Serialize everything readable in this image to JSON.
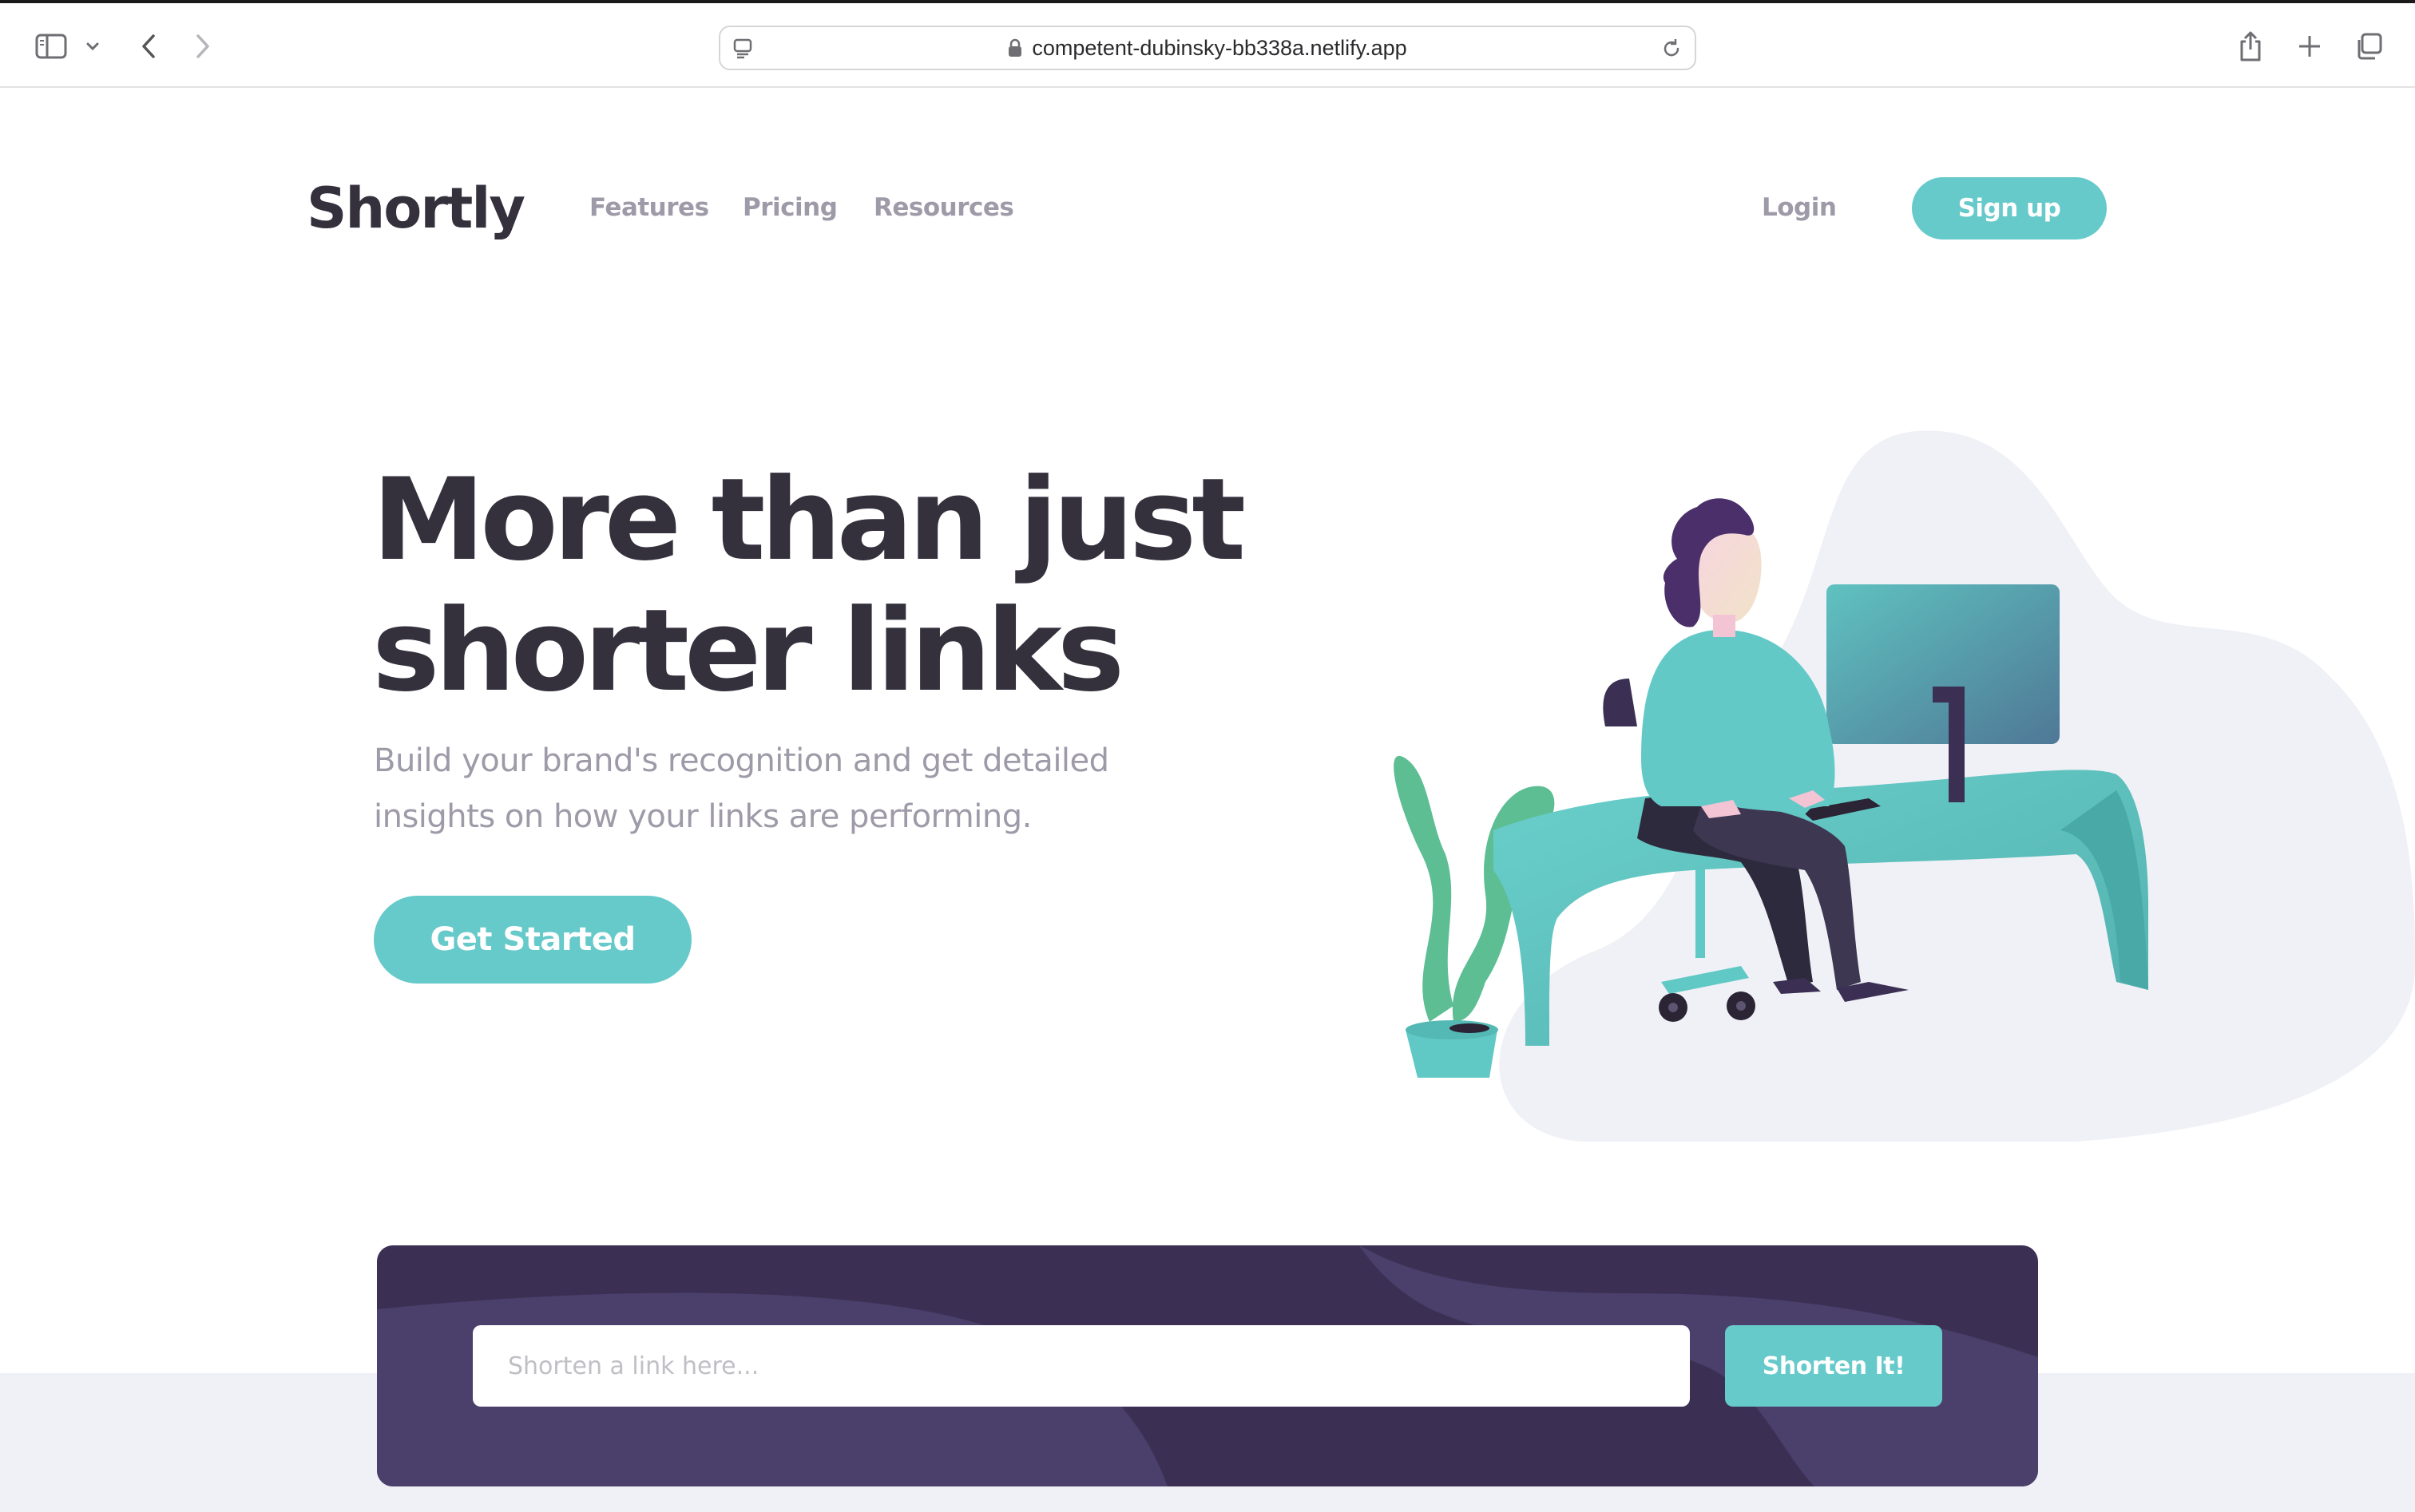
{
  "browser": {
    "url": "competent-dubinsky-bb338a.netlify.app"
  },
  "header": {
    "logo": "Shortly",
    "nav": [
      "Features",
      "Pricing",
      "Resources"
    ],
    "login": "Login",
    "signup": "Sign up"
  },
  "hero": {
    "title_line1": "More than just",
    "title_line2": "shorter links",
    "subtitle_line1": "Build your brand's recognition and get detailed",
    "subtitle_line2": "insights on how your links are performing.",
    "cta": "Get Started"
  },
  "shorten": {
    "placeholder": "Shorten a link here...",
    "button": "Shorten It!"
  },
  "colors": {
    "primary": "#66c9ca",
    "dark_violet": "#3b3054",
    "heading": "#34313d",
    "gray_text": "#9e9aa8",
    "band": "#f0f1f6"
  }
}
